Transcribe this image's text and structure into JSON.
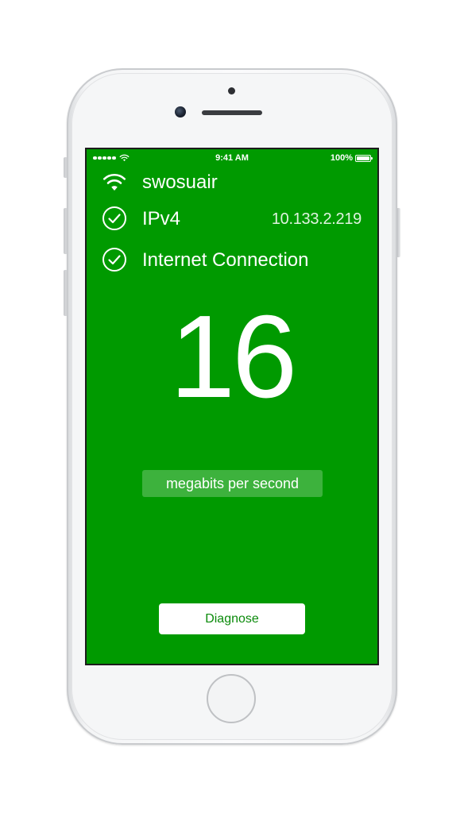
{
  "status_bar": {
    "time": "9:41 AM",
    "battery": "100%",
    "battery_level": 1.0,
    "signal_bars": 5
  },
  "network": {
    "ssid": "swosuair",
    "icon": "wifi-icon"
  },
  "ipv4": {
    "label": "IPv4",
    "address": "10.133.2.219",
    "icon": "checkmark-circle-icon"
  },
  "internet": {
    "label": "Internet Connection",
    "icon": "checkmark-circle-icon"
  },
  "speed": {
    "value": "16",
    "unit": "megabits per second"
  },
  "actions": {
    "diagnose_label": "Diagnose"
  },
  "colors": {
    "background": "#009a00",
    "foreground": "#ffffff",
    "button_text": "#0a8a0a"
  }
}
